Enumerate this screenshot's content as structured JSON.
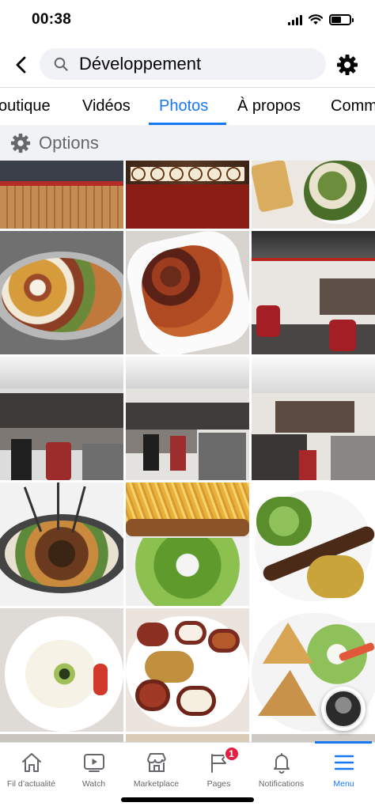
{
  "status_bar": {
    "time": "00:38"
  },
  "header": {
    "search_text": "Développement"
  },
  "tabs": [
    {
      "label": "outique"
    },
    {
      "label": "Vidéos"
    },
    {
      "label": "Photos"
    },
    {
      "label": "À propos"
    },
    {
      "label": "Comm"
    }
  ],
  "active_tab": "Photos",
  "options": {
    "label": "Options"
  },
  "photos": [
    "Restaurant terrace with wooden fence",
    "Dessert tartlets on a red platter",
    "Grilled flatbread with salad plate",
    "Mezze platter with dips and olives",
    "Meatballs in tomato sauce",
    "Restaurant interior with bar and red chairs",
    "Bar counter with stools",
    "Restaurant bar seating",
    "Dining room with wooden tables",
    "Mixed grill skewers platter",
    "Kebab with fries and salad",
    "Minced meat skewer with bulgur",
    "Yogurt dip with cucumber",
    "Assorted mezze bowls",
    "Samosas with salad"
  ],
  "bottom_nav": [
    {
      "label": "Fil d’actualité",
      "icon": "home-icon"
    },
    {
      "label": "Watch",
      "icon": "watch-icon"
    },
    {
      "label": "Marketplace",
      "icon": "marketplace-icon"
    },
    {
      "label": "Pages",
      "icon": "pages-flag-icon",
      "badge": "1"
    },
    {
      "label": "Notifications",
      "icon": "bell-icon"
    },
    {
      "label": "Menu",
      "icon": "menu-icon"
    }
  ],
  "active_nav": "Menu",
  "colors": {
    "accent": "#1877f2",
    "badge": "#e41e3f",
    "muted": "#65676b",
    "options_bg": "#f0f2f5"
  }
}
